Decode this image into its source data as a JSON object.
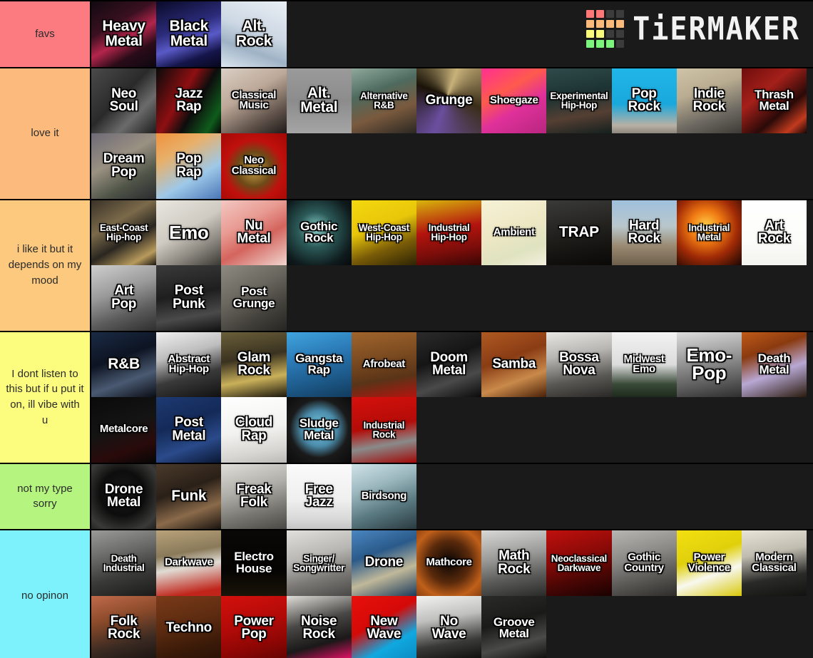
{
  "app": {
    "brand": "TiERMAKER",
    "logo_colors": [
      "#f77",
      "#f77",
      "#3c3c3c",
      "#3c3c3c",
      "#fcba7a",
      "#fcba7a",
      "#fcba7a",
      "#fcba7a",
      "#fbfb7b",
      "#fbfb7b",
      "#3c3c3c",
      "#3c3c3c",
      "#7cf57c",
      "#7cf57c",
      "#7cf57c",
      "#3c3c3c"
    ]
  },
  "background": "#1a1a1a",
  "tiers": [
    {
      "label": "favs",
      "color": "#fb7b80",
      "items": [
        {
          "name": "Heavy Metal",
          "lines": [
            "Heavy",
            "Metal"
          ],
          "size": "s1",
          "art": "linear-gradient(150deg,#120a10 0%,#3a1020 35%,#b4254c 55%,#2a0c18 75%,#0d0710 100%)"
        },
        {
          "name": "Black Metal",
          "lines": [
            "Black",
            "Metal"
          ],
          "size": "s1",
          "art": "linear-gradient(160deg,#0a0a28 0%,#2b2b7a 40%,#5a5ac8 60%,#15154a 80%,#07071c 100%)"
        },
        {
          "name": "Alt. Rock",
          "lines": [
            "Alt.",
            "Rock"
          ],
          "size": "s1",
          "art": "linear-gradient(200deg,#e8eef4 0%,#cdd8e4 45%,#9fb3c6 70%,#dce6ef 100%)"
        }
      ]
    },
    {
      "label": "love it",
      "color": "#fcbb7d",
      "items": [
        {
          "name": "Neo Soul",
          "lines": [
            "Neo",
            "Soul"
          ],
          "size": "s2",
          "art": "linear-gradient(135deg,#4a4a4a 0%,#2a2a2a 45%,#6b6b6b 70%,#1c1c1c 100%)"
        },
        {
          "name": "Jazz Rap",
          "lines": [
            "Jazz",
            "Rap"
          ],
          "size": "s2",
          "art": "linear-gradient(120deg,#0a0a0a 0%,#8e0f12 40%,#0d0d0d 60%,#0f5c1c 85%,#050505 100%)"
        },
        {
          "name": "Classical Music",
          "lines": [
            "Classical",
            "Music"
          ],
          "size": "s4",
          "art": "linear-gradient(150deg,#d9cfc4 0%,#bda898 40%,#5d5048 75%,#1e1a18 100%)"
        },
        {
          "name": "Alt. Metal",
          "lines": [
            "Alt.",
            "Metal"
          ],
          "size": "s1",
          "art": "linear-gradient(180deg,#9a9a9a 0%,#8c8c8c 50%,#a5a5a5 100%)"
        },
        {
          "name": "Alternative R&B",
          "lines": [
            "Alternative",
            "R&B"
          ],
          "size": "s5",
          "art": "linear-gradient(160deg,#8fa89c 0%,#4e6a5e 35%,#7a5a3e 65%,#2a2722 100%)"
        },
        {
          "name": "Grunge",
          "lines": [
            "Grunge"
          ],
          "size": "s2",
          "art": "conic-gradient(from 20deg at 48% 42%, #c8b27a, #3a2d18, #6b4fa0, #1a1308, #c8b27a)"
        },
        {
          "name": "Shoegaze",
          "lines": [
            "Shoegaze"
          ],
          "size": "s4",
          "art": "linear-gradient(150deg,#ff2f92 0%,#ff5a4d 35%,#e0319a 60%,#b8267f 100%)"
        },
        {
          "name": "Experimental Hip-Hop",
          "lines": [
            "Experimental",
            "Hip-Hop"
          ],
          "size": "s5",
          "art": "linear-gradient(170deg,#2f4a4a 0%,#1d3333 40%,#553f33 70%,#14201f 100%)"
        },
        {
          "name": "Pop Rock",
          "lines": [
            "Pop",
            "Rock"
          ],
          "size": "s2",
          "art": "linear-gradient(180deg,#21b6e8 0%,#1aa8dc 55%,#b9b0a4 88%,#8d867c 100%)"
        },
        {
          "name": "Indie Rock",
          "lines": [
            "Indie",
            "Rock"
          ],
          "size": "s2",
          "art": "linear-gradient(160deg,#cfc3a8 0%,#b9ac91 35%,#6e6a62 70%,#3c3a36 100%)"
        },
        {
          "name": "Thrash Metal",
          "lines": [
            "Thrash",
            "Metal"
          ],
          "size": "s3",
          "art": "linear-gradient(140deg,#6e0d0d 0%,#a5201a 35%,#2a0a08 65%,#c23a1e 85%,#180504 100%)"
        },
        {
          "name": "Dream Pop",
          "lines": [
            "Dream",
            "Pop"
          ],
          "size": "s2",
          "art": "linear-gradient(150deg,#6d6a77 0%,#9a9182 40%,#4f5548 70%,#2b2a2e 100%)"
        },
        {
          "name": "Pop Rap",
          "lines": [
            "Pop",
            "Rap"
          ],
          "size": "s2",
          "art": "linear-gradient(150deg,#f0913c 0%,#e8b06a 30%,#9ec8e8 65%,#4a76b8 100%)"
        },
        {
          "name": "Neo Classical",
          "lines": [
            "Neo",
            "Classical"
          ],
          "size": "s4",
          "art": "radial-gradient(circle at 50% 55%, #c9a14a 0%, #6d4a18 35%, #c0100c 60%, #a10805 100%)"
        }
      ]
    },
    {
      "label": "i like it but it depends on my mood",
      "color": "#fcc97f",
      "items": [
        {
          "name": "East-Coast Hip-hop",
          "lines": [
            "East-Coast",
            "Hip-hop"
          ],
          "size": "s5",
          "art": "linear-gradient(150deg,#3a3228 0%,#7b6a4a 35%,#2a2620 60%,#b89a5c 85%,#1a1712 100%)"
        },
        {
          "name": "Emo",
          "lines": [
            "Emo"
          ],
          "size": "s6",
          "art": "linear-gradient(150deg,#e9e6e0 0%,#cfcbc2 45%,#8c8880 72%,#3a3833 100%)"
        },
        {
          "name": "Nu Metal",
          "lines": [
            "Nu",
            "Metal"
          ],
          "size": "s2",
          "art": "linear-gradient(150deg,#f3c7c2 0%,#e89b92 35%,#d4645e 60%,#f0d6cf 100%)"
        },
        {
          "name": "Gothic Rock",
          "lines": [
            "Gothic",
            "Rock"
          ],
          "size": "s3",
          "art": "radial-gradient(circle at 45% 45%, #8fd6d2 0%, #2b5a58 35%, #0f1a1c 75%, #060a0c 100%)"
        },
        {
          "name": "West-Coast Hip-Hop",
          "lines": [
            "West-Coast",
            "Hip-Hop"
          ],
          "size": "s5",
          "art": "linear-gradient(160deg,#f3d80e 0%,#e8c60a 40%,#7a5c08 70%,#2e2404 100%)"
        },
        {
          "name": "Industrial Hip-Hop",
          "lines": [
            "Industrial",
            "Hip-Hop"
          ],
          "size": "s5",
          "art": "linear-gradient(170deg,#d8b60c 0%,#b4140e 45%,#7a0d0a 75%,#3a0604 100%)"
        },
        {
          "name": "Ambient",
          "lines": [
            "Ambient"
          ],
          "size": "s4",
          "art": "linear-gradient(160deg,#f6f2d6 0%,#eee7c4 45%,#dfe3c0 75%,#f3efdd 100%)"
        },
        {
          "name": "TRAP",
          "lines": [
            "TRAP"
          ],
          "size": "s1",
          "art": "linear-gradient(170deg,#3a3a38 0%,#23221f 45%,#141310 75%,#0a0908 100%)"
        },
        {
          "name": "Hard Rock",
          "lines": [
            "Hard",
            "Rock"
          ],
          "size": "s2",
          "art": "linear-gradient(180deg,#9fc0dd 0%,#b9c7cc 40%,#9a8a72 70%,#6e5f4c 100%)"
        },
        {
          "name": "Industrial Metal",
          "lines": [
            "Industrial",
            "Metal"
          ],
          "size": "s5",
          "art": "radial-gradient(circle at 45% 40%, #ffd24a 0%, #f07a12 30%, #a02a06 60%, #180603 100%)"
        },
        {
          "name": "Art Rock",
          "lines": [
            "Art",
            "Rock"
          ],
          "size": "s2",
          "art": "linear-gradient(180deg,#ffffff 0%,#fcfcfa 60%,#f3f3ef 100%)"
        },
        {
          "name": "Art Pop",
          "lines": [
            "Art",
            "Pop"
          ],
          "size": "s2",
          "art": "linear-gradient(160deg,#cfcfcf 0%,#9a9a9a 40%,#5c5c5c 70%,#2e2e2e 100%)"
        },
        {
          "name": "Post Punk",
          "lines": [
            "Post",
            "Punk"
          ],
          "size": "s2",
          "art": "linear-gradient(170deg,#3a3a3a 0%,#1e1e1e 45%,#4a4a4a 75%,#111 100%)"
        },
        {
          "name": "Post Grunge",
          "lines": [
            "Post",
            "Grunge"
          ],
          "size": "s3",
          "art": "linear-gradient(150deg,#8e8a82 0%,#6a675f 40%,#44423c 70%,#262522 100%)"
        }
      ]
    },
    {
      "label": "I dont listen to this but if u put it on, ill vibe with u",
      "color": "#fcfc7f",
      "items": [
        {
          "name": "R&B",
          "lines": [
            "R&B"
          ],
          "size": "s1",
          "art": "linear-gradient(160deg,#1a2a44 0%,#0d1422 40%,#4a5a72 70%,#0a0d14 100%)"
        },
        {
          "name": "Abstract Hip-Hop",
          "lines": [
            "Abstract",
            "Hip-Hop"
          ],
          "size": "s4",
          "art": "linear-gradient(165deg,#f0f0f0 0%,#bdbdbd 35%,#3a3a3a 65%,#111 100%)"
        },
        {
          "name": "Glam Rock",
          "lines": [
            "Glam",
            "Rock"
          ],
          "size": "s2",
          "art": "linear-gradient(170deg,#6a5f3a 0%,#3a3220 40%,#c9b05a 70%,#1a160d 100%)"
        },
        {
          "name": "Gangsta Rap",
          "lines": [
            "Gangsta",
            "Rap"
          ],
          "size": "s3",
          "art": "linear-gradient(165deg,#3fa4de 0%,#2a78b4 40%,#1d5a8a 70%,#123b5c 100%)"
        },
        {
          "name": "Afrobeat",
          "lines": [
            "Afrobeat"
          ],
          "size": "s4",
          "art": "linear-gradient(170deg,#a0642c 0%,#7a4a20 40%,#5a3418 70%,#b4140e 100%)"
        },
        {
          "name": "Doom Metal",
          "lines": [
            "Doom",
            "Metal"
          ],
          "size": "s2",
          "art": "linear-gradient(160deg,#2b2b2b 0%,#151515 40%,#4a4a4a 70%,#0a0a0a 100%)"
        },
        {
          "name": "Samba",
          "lines": [
            "Samba"
          ],
          "size": "s2",
          "art": "linear-gradient(160deg,#b05a22 0%,#8a3c14 40%,#c98a4a 70%,#4a2008 100%)"
        },
        {
          "name": "Bossa Nova",
          "lines": [
            "Bossa",
            "Nova"
          ],
          "size": "s2",
          "art": "linear-gradient(170deg,#e8e6e2 0%,#b8b6b2 35%,#5a5854 70%,#2a2826 100%)"
        },
        {
          "name": "Midwest Emo",
          "lines": [
            "Midwest",
            "Emo"
          ],
          "size": "s4",
          "art": "linear-gradient(180deg,#f2f2f2 0%,#dcdcdc 50%,#3a4a38 80%,#1e2a1d 100%)"
        },
        {
          "name": "Emo-Pop",
          "lines": [
            "Emo-",
            "Pop"
          ],
          "size": "s6",
          "art": "linear-gradient(170deg,#dcdcdc 0%,#9a9a9a 40%,#5c5c5c 75%,#2e2e2e 100%)"
        },
        {
          "name": "Death Metal",
          "lines": [
            "Death",
            "Metal"
          ],
          "size": "s3",
          "art": "linear-gradient(160deg,#c05a18 0%,#8a3a10 30%,#b8a8d4 60%,#2a1a0c 100%)"
        },
        {
          "name": "Metalcore",
          "lines": [
            "Metalcore"
          ],
          "size": "s4",
          "art": "linear-gradient(160deg,#0a0a0a 0%,#141414 45%,#2a0a0a 75%,#060606 100%)"
        },
        {
          "name": "Post Metal",
          "lines": [
            "Post",
            "Metal"
          ],
          "size": "s2",
          "art": "linear-gradient(160deg,#1d3a72 0%,#142a58 40%,#2a4a8a 70%,#0a1733 100%)"
        },
        {
          "name": "Cloud Rap",
          "lines": [
            "Cloud",
            "Rap"
          ],
          "size": "s2",
          "art": "linear-gradient(170deg,#ffffff 0%,#f2f2f0 50%,#d8d6d2 80%,#bcbab6 100%)"
        },
        {
          "name": "Sludge Metal",
          "lines": [
            "Sludge",
            "Metal"
          ],
          "size": "s3",
          "art": "radial-gradient(circle at 50% 48%, #7fd4ef 0%, #4a8aa8 38%, #1a1a1a 62%, #0a0a0a 100%)"
        },
        {
          "name": "Industrial Rock",
          "lines": [
            "Industrial",
            "Rock"
          ],
          "size": "s5",
          "art": "linear-gradient(170deg,#d4100c 0%,#b40c08 45%,#8a8a8a 70%,#a00806 100%)"
        }
      ]
    },
    {
      "label": "not my type sorry",
      "color": "#b5f57f",
      "items": [
        {
          "name": "Drone Metal",
          "lines": [
            "Drone",
            "Metal"
          ],
          "size": "s2",
          "art": "radial-gradient(circle at 48% 45%, #1a1a1a 0%, #0d0d0d 45%, #3a3a38 80%, #202020 100%)"
        },
        {
          "name": "Funk",
          "lines": [
            "Funk"
          ],
          "size": "s1",
          "art": "linear-gradient(160deg,#4a3a2a 0%,#2a2018 40%,#8a6a4a 70%,#1a1410 100%)"
        },
        {
          "name": "Freak Folk",
          "lines": [
            "Freak",
            "Folk"
          ],
          "size": "s2",
          "art": "linear-gradient(165deg,#e0ded8 0%,#b0aea8 40%,#7a7872 70%,#4a4844 100%)"
        },
        {
          "name": "Free Jazz",
          "lines": [
            "Free",
            "Jazz"
          ],
          "size": "s2",
          "art": "linear-gradient(180deg,#fafafa 0%,#efefef 55%,#d8d8d8 85%,#c4c4c4 100%)"
        },
        {
          "name": "Birdsong",
          "lines": [
            "Birdsong"
          ],
          "size": "s4",
          "art": "linear-gradient(160deg,#cfe3e8 0%,#9ab6bd 35%,#5a7a82 65%,#2a3a40 100%)"
        }
      ]
    },
    {
      "label": "no opinon",
      "color": "#7ef2fc",
      "items": [
        {
          "name": "Death Industrial",
          "lines": [
            "Death",
            "Industrial"
          ],
          "size": "s5",
          "art": "linear-gradient(165deg,#9a9a98 0%,#6a6a68 35%,#3a3a38 65%,#1a1a18 100%)"
        },
        {
          "name": "Darkwave",
          "lines": [
            "Darkwave"
          ],
          "size": "s4",
          "art": "linear-gradient(170deg,#b8a27a 0%,#8a7a5a 35%,#e0dcd4 55%,#c0241a 90%)"
        },
        {
          "name": "Electro House",
          "lines": [
            "Electro",
            "House"
          ],
          "size": "s3",
          "art": "linear-gradient(180deg,#0a0806 0%,#050403 60%,#1a1408 100%)"
        },
        {
          "name": "Singer/Songwritter",
          "lines": [
            "Singer/",
            "Songwritter"
          ],
          "size": "s5",
          "art": "linear-gradient(165deg,#e2e0dc 0%,#b8b6b2 40%,#7a7874 70%,#4a4846 100%)"
        },
        {
          "name": "Drone",
          "lines": [
            "Drone"
          ],
          "size": "s2",
          "art": "linear-gradient(160deg,#4a86c0 0%,#2a5a8a 35%,#c0b89a 65%,#1a3a5a 100%)"
        },
        {
          "name": "Mathcore",
          "lines": [
            "Mathcore"
          ],
          "size": "s4",
          "art": "radial-gradient(circle at 50% 48%, #0a0604 0%, #5a2a0c 45%, #c0601a 75%, #8a4010 100%)"
        },
        {
          "name": "Math Rock",
          "lines": [
            "Math",
            "Rock"
          ],
          "size": "s2",
          "art": "linear-gradient(170deg,#d8d8d6 0%,#9a9a98 40%,#5a5a58 70%,#2a2a28 100%)"
        },
        {
          "name": "Neoclassical Darkwave",
          "lines": [
            "Neoclassical",
            "Darkwave"
          ],
          "size": "s5",
          "art": "linear-gradient(165deg,#c0100c 0%,#8a0a08 40%,#4a0604 70%,#1a0202 100%)"
        },
        {
          "name": "Gothic Country",
          "lines": [
            "Gothic",
            "Country"
          ],
          "size": "s4",
          "art": "linear-gradient(165deg,#b8b6b2 0%,#8a8884 40%,#5a5854 70%,#2e2c2a 100%)"
        },
        {
          "name": "Power Violence",
          "lines": [
            "Power",
            "Violence"
          ],
          "size": "s4",
          "art": "linear-gradient(160deg,#f2e010 0%,#e0d00c 40%,#f8f8f0 65%,#d8c808 100%)"
        },
        {
          "name": "Modern Classical",
          "lines": [
            "Modern",
            "Classical"
          ],
          "size": "s4",
          "art": "linear-gradient(170deg,#e8e4d8 0%,#c0bcb0 35%,#2a2a28 70%,#121210 100%)"
        },
        {
          "name": "Folk Rock",
          "lines": [
            "Folk",
            "Rock"
          ],
          "size": "s2",
          "art": "linear-gradient(165deg,#c06a4a 0%,#8a4a2a 35%,#3a2a22 70%,#1a1210 100%)"
        },
        {
          "name": "Techno",
          "lines": [
            "Techno"
          ],
          "size": "s2",
          "art": "linear-gradient(165deg,#7a3a18 0%,#5a2a10 45%,#3a1a08 75%,#2a1206 100%)"
        },
        {
          "name": "Power Pop",
          "lines": [
            "Power",
            "Pop"
          ],
          "size": "s2",
          "art": "linear-gradient(165deg,#d4100c 0%,#b00a08 45%,#8a0604 75%,#600402 100%)"
        },
        {
          "name": "Noise Rock",
          "lines": [
            "Noise",
            "Rock"
          ],
          "size": "s2",
          "art": "linear-gradient(165deg,#e0ded8 0%,#4a4846 40%,#1a1818 70%,#d41060 95%)"
        },
        {
          "name": "New Wave",
          "lines": [
            "New",
            "Wave"
          ],
          "size": "s2",
          "art": "linear-gradient(150deg,#e8100c 0%,#d40a08 40%,#10a8e0 70%,#0a8ac0 100%)"
        },
        {
          "name": "No Wave",
          "lines": [
            "No",
            "Wave"
          ],
          "size": "s2",
          "art": "linear-gradient(170deg,#f2f2f0 0%,#c0c0be 35%,#3a3a38 70%,#0a0a0a 100%)"
        },
        {
          "name": "Groove Metal",
          "lines": [
            "Groove",
            "Metal"
          ],
          "size": "s3",
          "art": "linear-gradient(165deg,#2a2a28 0%,#1a1a18 40%,#4a4a48 70%,#0a0a08 100%)"
        }
      ]
    }
  ]
}
